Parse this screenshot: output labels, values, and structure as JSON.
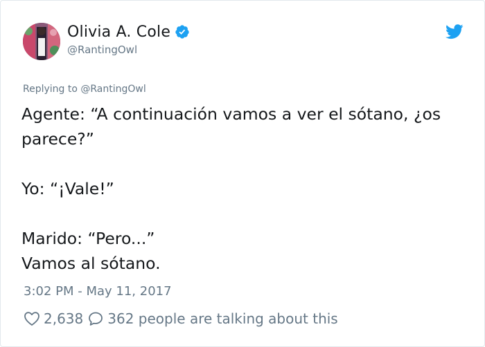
{
  "author": {
    "display_name": "Olivia A. Cole",
    "handle": "@RantingOwl",
    "verified": true
  },
  "reply_to": "Replying to @RantingOwl",
  "tweet": {
    "lines": [
      "Agente: “A continuación vamos a ver el sótano, ¿os parece?”",
      "Yo: “¡Vale!”",
      "Marido: “Pero...”",
      "Vamos al sótano."
    ]
  },
  "timestamp": "3:02 PM - May 11, 2017",
  "actions": {
    "likes": "2,638",
    "talking": "362 people are talking about this"
  },
  "colors": {
    "brand_blue": "#1da1f2",
    "muted_text": "#657786",
    "text": "#14171a",
    "border": "#e1e8ed"
  },
  "icons": {
    "avatar": "avatar-image",
    "verified": "verified-badge-icon",
    "platform": "twitter-bird-icon",
    "like": "heart-icon",
    "reply": "speech-bubble-icon"
  }
}
